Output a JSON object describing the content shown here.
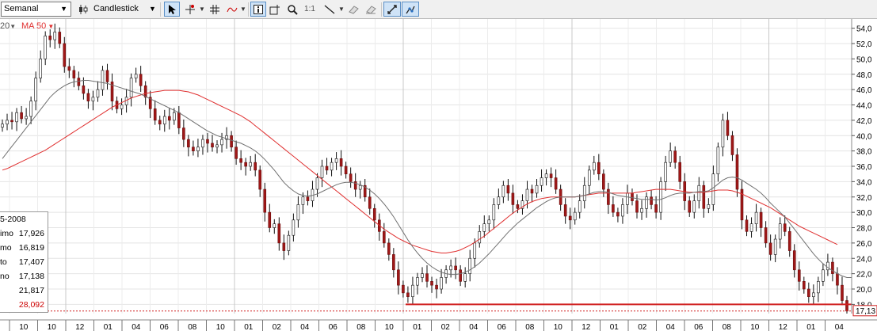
{
  "toolbar": {
    "period_value": "Semanal",
    "chart_type_label": "Candlestick",
    "zoom_label": "1:1",
    "icons": [
      "pointer-icon",
      "crosshair-icon",
      "grid-icon",
      "indicator-icon",
      "info-icon",
      "add-chart-icon",
      "zoom-icon",
      "zoom-1to1-icon",
      "line-draw-icon",
      "eraser-icon",
      "erase-all-icon",
      "autoscale-icon",
      "snap-icon"
    ]
  },
  "indicators": {
    "ma20_label": "20",
    "ma50_label": "MA 50",
    "ma20_color": "#707070",
    "ma50_color": "#e03030"
  },
  "info_box": {
    "date": "5-2008",
    "rows": [
      {
        "label": "imo",
        "value": "17,926"
      },
      {
        "label": "mo",
        "value": "16,819"
      },
      {
        "label": "to",
        "value": "17,407"
      },
      {
        "label": "no",
        "value": "17,138"
      },
      {
        "label": "",
        "value": "21,817"
      },
      {
        "label": "",
        "value": "28,092"
      }
    ],
    "highlight_color": "#cc0000"
  },
  "chart_data": {
    "type": "candlestick",
    "period": "weekly",
    "y_axis_ticks": [
      "54,0",
      "52,0",
      "50,0",
      "48,0",
      "46,0",
      "44,0",
      "42,0",
      "40,0",
      "38,0",
      "36,0",
      "34,0",
      "32,0",
      "30,0",
      "28,0",
      "26,0",
      "24,0",
      "22,0",
      "20,0",
      "18,0"
    ],
    "ylim": [
      16.8,
      55.2
    ],
    "x_axis_ticks": [
      "10",
      "10",
      "12",
      "01",
      "04",
      "06",
      "08",
      "10",
      "01",
      "02",
      "04",
      "06",
      "08",
      "10",
      "01",
      "02",
      "04",
      "06",
      "08",
      "10",
      "12",
      "01",
      "02",
      "04",
      "06",
      "08",
      "10",
      "12",
      "01",
      "04"
    ],
    "last_price_label": "17,13",
    "last_price": 17.13,
    "support_level": 18.0,
    "closes": [
      41.5,
      42.0,
      41.8,
      43.0,
      42.2,
      42.5,
      44.5,
      47.5,
      50.0,
      53.0,
      52.5,
      53.5,
      52.0,
      49.0,
      48.5,
      47.5,
      46.5,
      45.5,
      44.5,
      45.0,
      46.0,
      48.5,
      47.0,
      44.5,
      43.5,
      44.0,
      45.0,
      47.5,
      48.0,
      46.5,
      45.0,
      43.5,
      42.0,
      41.5,
      42.5,
      42.0,
      43.0,
      41.0,
      39.5,
      38.5,
      38.0,
      38.5,
      39.5,
      39.0,
      38.5,
      38.8,
      39.5,
      40.0,
      38.5,
      37.0,
      36.5,
      36.0,
      36.5,
      35.5,
      33.0,
      30.0,
      28.0,
      28.5,
      26.0,
      25.0,
      27.0,
      29.0,
      31.0,
      32.0,
      31.5,
      33.0,
      34.5,
      36.0,
      35.5,
      36.5,
      37.0,
      36.0,
      35.0,
      34.0,
      33.0,
      33.5,
      32.0,
      30.5,
      29.0,
      27.5,
      26.0,
      24.5,
      22.5,
      20.5,
      19.5,
      19.0,
      20.5,
      21.5,
      22.0,
      21.0,
      20.5,
      20.0,
      21.5,
      22.5,
      23.0,
      22.5,
      21.0,
      22.0,
      24.0,
      26.0,
      27.5,
      28.5,
      29.0,
      31.0,
      32.0,
      33.5,
      32.5,
      31.0,
      30.5,
      31.5,
      33.0,
      32.5,
      33.5,
      34.5,
      35.0,
      34.5,
      33.0,
      31.0,
      29.5,
      29.0,
      30.0,
      31.5,
      33.5,
      35.5,
      36.5,
      35.0,
      33.0,
      31.0,
      30.0,
      29.5,
      31.0,
      32.5,
      31.5,
      30.0,
      30.5,
      32.0,
      31.0,
      30.0,
      34.0,
      36.5,
      38.0,
      36.5,
      34.0,
      31.5,
      30.0,
      31.5,
      33.5,
      30.5,
      31.0,
      35.0,
      38.5,
      42.0,
      40.0,
      37.5,
      33.0,
      29.0,
      27.5,
      28.5,
      30.0,
      28.0,
      26.0,
      24.5,
      26.5,
      28.5,
      27.5,
      25.0,
      22.5,
      21.0,
      20.0,
      19.0,
      19.5,
      21.0,
      22.5,
      23.5,
      22.0,
      20.5,
      18.5,
      17.13
    ],
    "ma20": [
      37.0,
      37.8,
      38.6,
      39.4,
      40.2,
      41.0,
      41.8,
      42.6,
      43.4,
      44.2,
      45.0,
      45.6,
      46.1,
      46.5,
      46.8,
      47.0,
      47.1,
      47.2,
      47.2,
      47.1,
      47.0,
      46.9,
      46.8,
      46.6,
      46.4,
      46.2,
      46.0,
      45.8,
      45.6,
      45.4,
      45.1,
      44.8,
      44.5,
      44.2,
      43.9,
      43.6,
      43.3,
      43.0,
      42.6,
      42.2,
      41.8,
      41.4,
      41.0,
      40.6,
      40.3,
      40.0,
      39.8,
      39.6,
      39.4,
      39.2,
      39.0,
      38.7,
      38.4,
      38.0,
      37.5,
      36.9,
      36.2,
      35.5,
      34.7,
      33.9,
      33.3,
      32.8,
      32.4,
      32.2,
      32.1,
      32.2,
      32.4,
      32.7,
      33.0,
      33.3,
      33.6,
      33.8,
      33.9,
      33.9,
      33.8,
      33.6,
      33.3,
      32.9,
      32.4,
      31.8,
      31.1,
      30.3,
      29.4,
      28.4,
      27.4,
      26.4,
      25.5,
      24.7,
      24.0,
      23.4,
      22.9,
      22.5,
      22.2,
      22.0,
      21.9,
      21.9,
      22.0,
      22.2,
      22.5,
      22.9,
      23.4,
      24.0,
      24.6,
      25.3,
      26.0,
      26.7,
      27.4,
      28.0,
      28.6,
      29.1,
      29.6,
      30.1,
      30.6,
      31.0,
      31.4,
      31.7,
      31.9,
      32.0,
      32.0,
      32.0,
      32.0,
      32.1,
      32.2,
      32.4,
      32.6,
      32.7,
      32.7,
      32.6,
      32.4,
      32.2,
      32.1,
      32.0,
      31.9,
      31.8,
      31.7,
      31.7,
      31.7,
      31.6,
      31.7,
      31.9,
      32.2,
      32.4,
      32.5,
      32.5,
      32.5,
      32.6,
      32.7,
      32.7,
      32.8,
      33.2,
      33.7,
      34.2,
      34.5,
      34.6,
      34.5,
      34.2,
      33.8,
      33.4,
      33.0,
      32.5,
      31.9,
      31.2,
      30.6,
      30.0,
      29.4,
      28.6,
      27.8,
      27.0,
      26.2,
      25.4,
      24.6,
      23.9,
      23.3,
      22.8,
      22.4,
      22.0,
      21.7,
      21.5,
      21.5
    ],
    "ma50": [
      35.5,
      35.7,
      36.0,
      36.3,
      36.6,
      36.9,
      37.2,
      37.5,
      37.8,
      38.1,
      38.5,
      38.9,
      39.3,
      39.7,
      40.1,
      40.5,
      40.9,
      41.3,
      41.7,
      42.1,
      42.5,
      42.9,
      43.3,
      43.7,
      44.0,
      44.3,
      44.6,
      44.9,
      45.1,
      45.3,
      45.5,
      45.6,
      45.7,
      45.8,
      45.9,
      45.9,
      45.9,
      45.9,
      45.8,
      45.7,
      45.5,
      45.3,
      45.0,
      44.7,
      44.4,
      44.1,
      43.8,
      43.5,
      43.2,
      42.9,
      42.6,
      42.2,
      41.8,
      41.3,
      40.8,
      40.3,
      39.8,
      39.3,
      38.8,
      38.3,
      37.8,
      37.3,
      36.8,
      36.3,
      35.8,
      35.3,
      34.8,
      34.3,
      33.8,
      33.3,
      32.8,
      32.3,
      31.8,
      31.3,
      30.8,
      30.3,
      29.8,
      29.3,
      28.8,
      28.3,
      27.8,
      27.4,
      27.0,
      26.6,
      26.3,
      26.0,
      25.7,
      25.5,
      25.3,
      25.1,
      24.9,
      24.8,
      24.7,
      24.7,
      24.8,
      24.9,
      25.1,
      25.4,
      25.7,
      26.1,
      26.5,
      26.9,
      27.4,
      27.9,
      28.4,
      28.9,
      29.4,
      29.9,
      30.3,
      30.7,
      31.1,
      31.4,
      31.6,
      31.8,
      31.9,
      32.0,
      32.0,
      32.0,
      32.0,
      32.0,
      32.0,
      32.1,
      32.2,
      32.3,
      32.4,
      32.5,
      32.5,
      32.5,
      32.5,
      32.5,
      32.5,
      32.5,
      32.5,
      32.6,
      32.7,
      32.8,
      32.9,
      33.0,
      33.0,
      33.0,
      33.0,
      32.9,
      32.8,
      32.7,
      32.6,
      32.6,
      32.6,
      32.6,
      32.7,
      32.8,
      32.9,
      32.9,
      32.9,
      32.8,
      32.6,
      32.4,
      32.1,
      31.8,
      31.5,
      31.2,
      30.9,
      30.6,
      30.2,
      29.8,
      29.4,
      29.0,
      28.6,
      28.2,
      27.9,
      27.6,
      27.3,
      27.0,
      26.7,
      26.4,
      26.1,
      25.8
    ]
  }
}
